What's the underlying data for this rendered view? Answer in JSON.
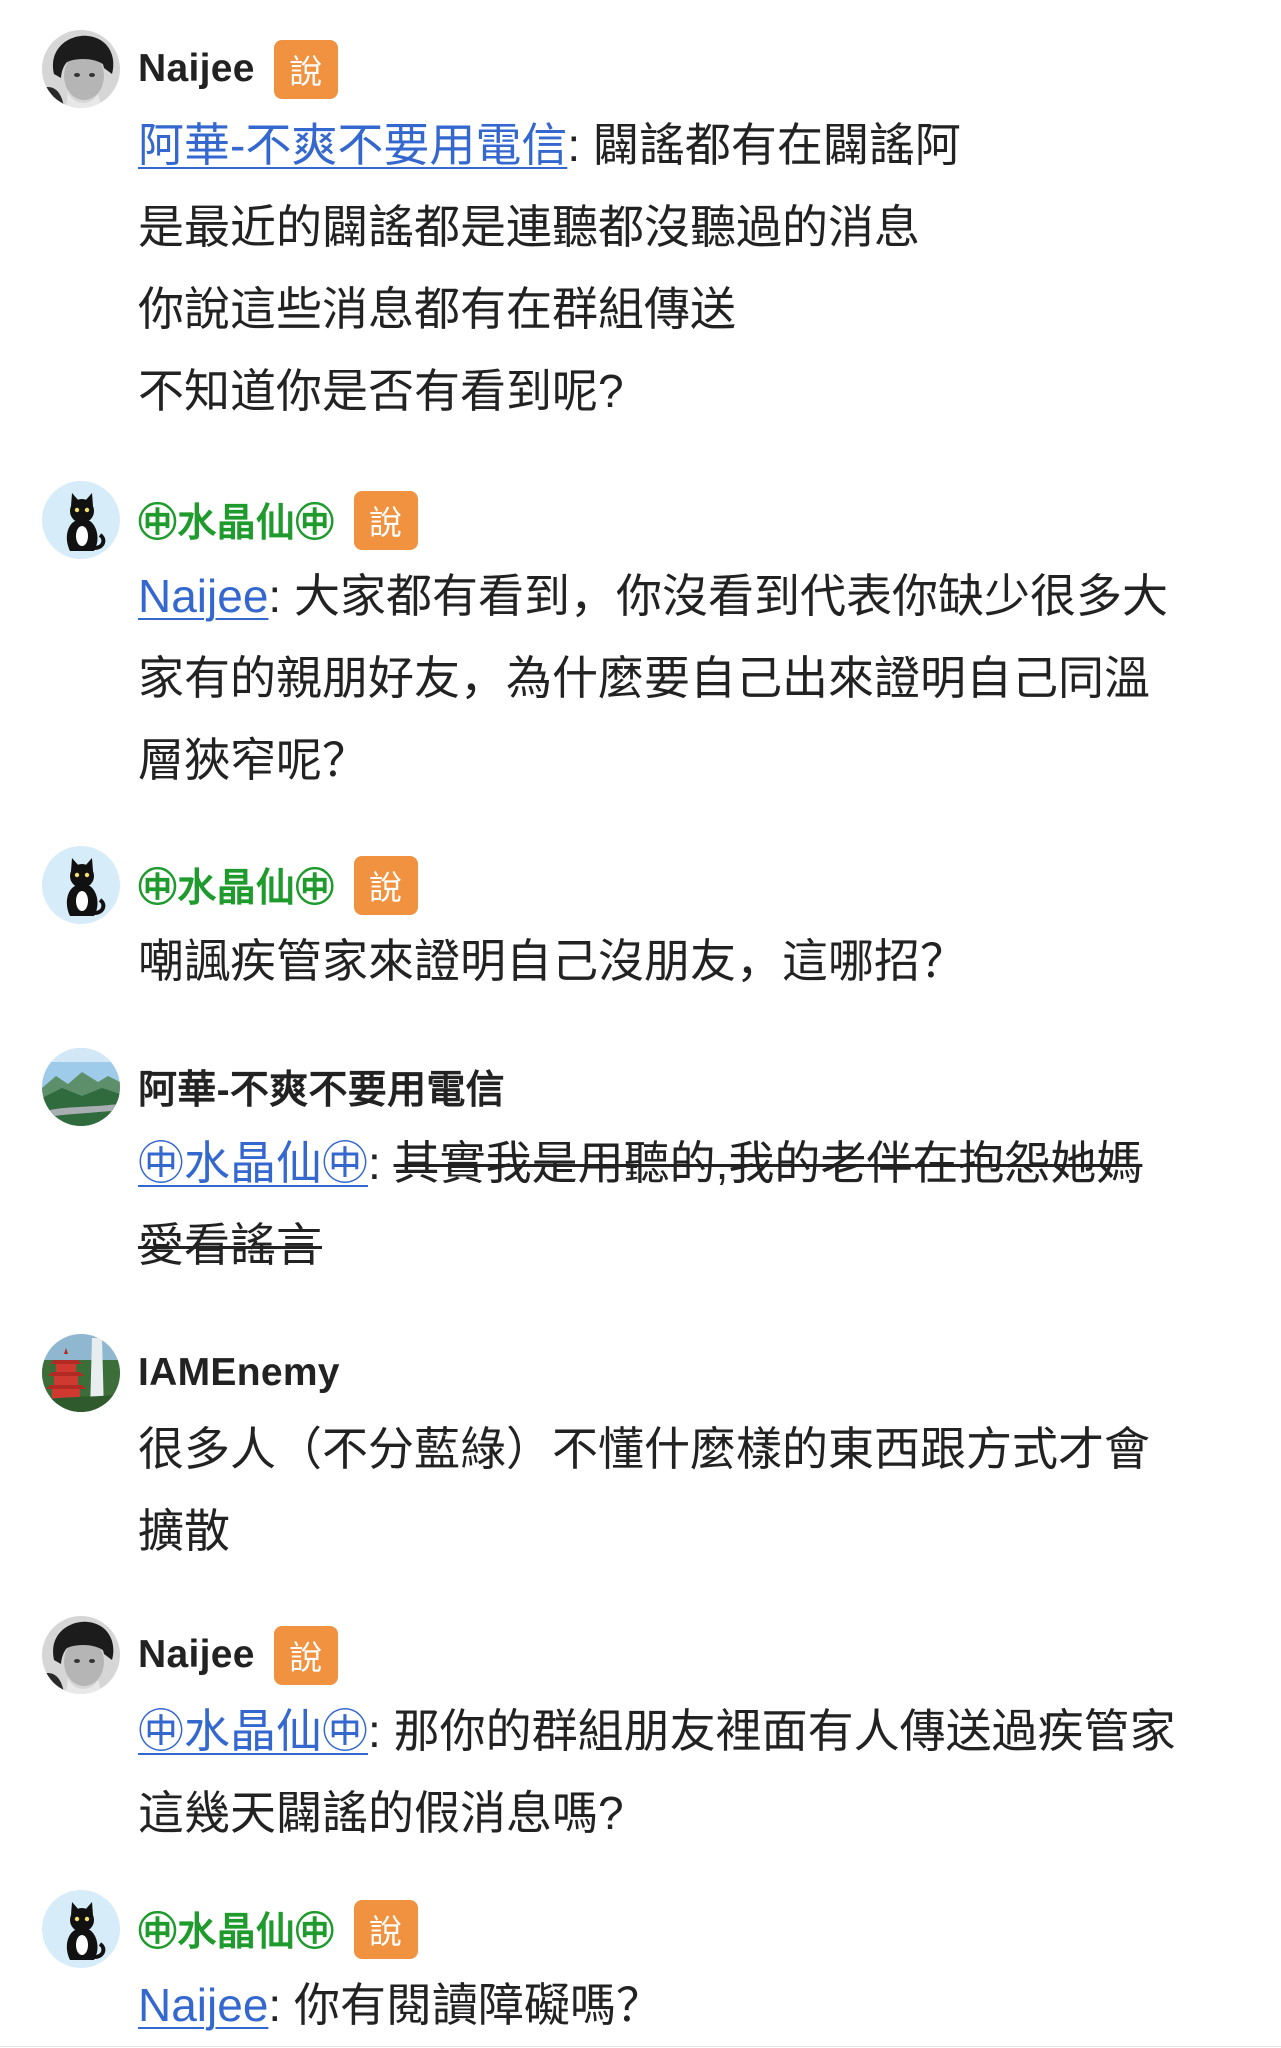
{
  "colors": {
    "text": "#222222",
    "link": "#3568cf",
    "green_name": "#1f9a2c",
    "badge_bg": "#f0923f",
    "badge_text": "#ffffff"
  },
  "posts": [
    {
      "user": "Naijee",
      "badge": "說",
      "avatar_icon": "person-photo-avatar",
      "mention": "阿華-不爽不要用電信",
      "separator": ": ",
      "lines": [
        "闢謠都有在闢謠阿",
        "是最近的闢謠都是連聽都沒聽過的消息",
        "你說這些消息都有在群組傳送",
        "不知道你是否有看到呢?"
      ]
    },
    {
      "user": "㊥水晶仙㊥",
      "badge": "說",
      "avatar_icon": "black-cat-avatar",
      "mention": "Naijee",
      "separator": ": ",
      "lines": [
        "大家都有看到，你沒看到代表你缺少很多大",
        "家有的親朋好友，為什麼要自己出來證明自己同溫",
        "層狹窄呢？"
      ]
    },
    {
      "user": "㊥水晶仙㊥",
      "badge": "說",
      "avatar_icon": "black-cat-avatar",
      "lines": [
        "嘲諷疾管家來證明自己沒朋友，這哪招？"
      ]
    },
    {
      "user": "阿華-不爽不要用電信",
      "avatar_icon": "mountain-landscape-avatar",
      "mention": "㊥水晶仙㊥",
      "separator": ": ",
      "strikethrough": true,
      "lines": [
        "其實我是用聽的,我的老伴在抱怨她媽",
        "愛看謠言"
      ]
    },
    {
      "user": "IAMEnemy",
      "avatar_icon": "pagoda-waterfall-avatar",
      "lines": [
        "很多人（不分藍綠）不懂什麼樣的東西跟方式才會",
        "擴散"
      ]
    },
    {
      "user": "Naijee",
      "badge": "說",
      "avatar_icon": "person-photo-avatar",
      "mention": "㊥水晶仙㊥",
      "separator": ": ",
      "lines": [
        "那你的群組朋友裡面有人傳送過疾管家",
        "這幾天闢謠的假消息嗎?"
      ]
    },
    {
      "user": "㊥水晶仙㊥",
      "badge": "說",
      "avatar_icon": "black-cat-avatar",
      "mention": "Naijee",
      "separator": ": ",
      "lines": [
        "你有閱讀障礙嗎？"
      ]
    }
  ]
}
